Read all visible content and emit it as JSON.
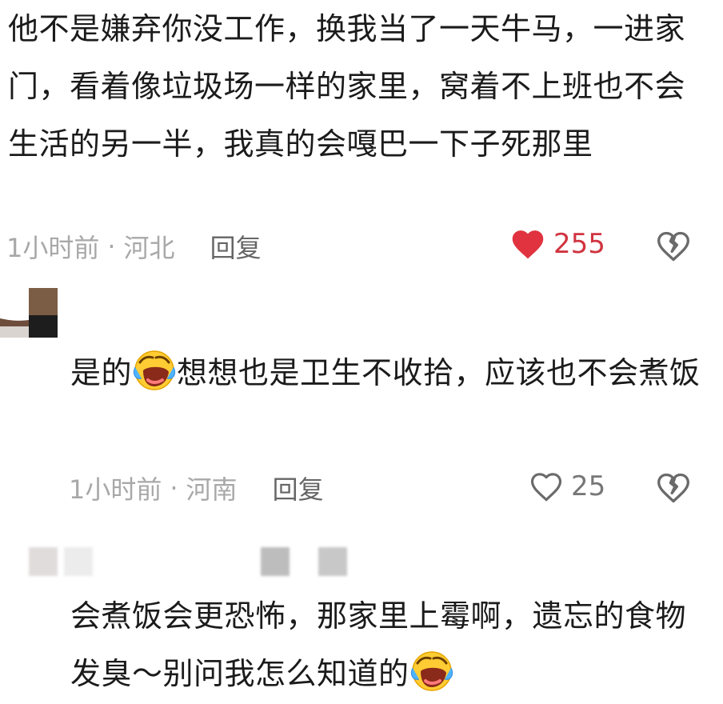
{
  "comment1": {
    "text": "他不是嫌弃你没工作，换我当了一天牛马，一进家门，看着像垃圾场一样的家里，窝着不上班也不会生活的另一半，我真的会嘎巴一下子死那里",
    "time": "1小时前",
    "separator": "·",
    "location": "河北",
    "reply_label": "回复",
    "likes": "255",
    "liked": true
  },
  "reply1": {
    "text_before": "是的",
    "emoji": "laughing-crying-emoji",
    "text_after": "想想也是卫生不收拾，应该也不会煮饭",
    "time": "1小时前",
    "separator": "·",
    "location": "河南",
    "reply_label": "回复",
    "likes": "25",
    "liked": false
  },
  "reply2": {
    "text_before": "会煮饭会更恐怖，那家里上霉啊，遗忘的食物发臭～别问我怎么知道的",
    "emoji": "laughing-crying-emoji"
  },
  "colors": {
    "liked_heart": "#e0333f",
    "meta_text": "#a8a8a8",
    "body_text": "#1b1b1b"
  }
}
